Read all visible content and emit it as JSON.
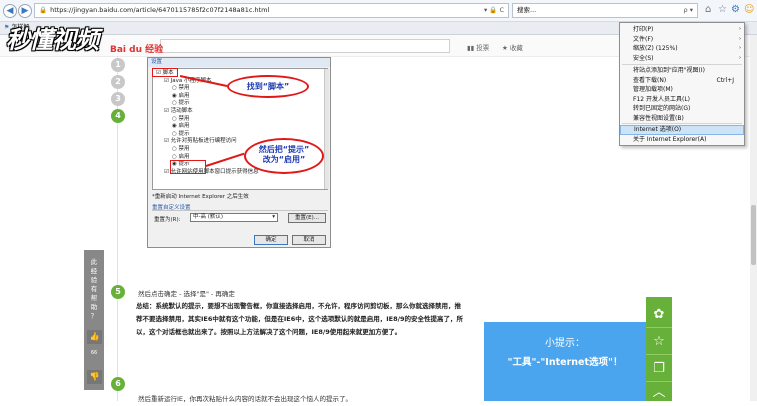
{
  "browser": {
    "url": "https://jingyan.baidu.com/article/6470115785f2c07f2148a81c.html",
    "search_placeholder": "搜索...",
    "tab_label": "怎样解",
    "nav_back": "◀",
    "nav_forward": "▶",
    "lock": "🔒",
    "addr_controls": "▾ 🔒 C",
    "search_controls": "ρ ▾",
    "icons": [
      "home-icon",
      "star-icon",
      "gear-icon",
      "smiley-icon"
    ]
  },
  "watermark": {
    "main": "秒懂视频",
    "sub": "Bai du 经验"
  },
  "header": {
    "link1": "▮▮ 投票",
    "link2": "★ 收藏"
  },
  "steps": [
    "1",
    "2",
    "3",
    "4",
    "5",
    "6"
  ],
  "dialog": {
    "caption": "设置",
    "items": [
      {
        "text": "☑ 脚本",
        "level": 0
      },
      {
        "text": "☑ Java 小程序脚本",
        "level": 1
      },
      {
        "text": "○ 禁用",
        "level": 2
      },
      {
        "text": "◉ 启用",
        "level": 2
      },
      {
        "text": "○ 提示",
        "level": 2
      },
      {
        "text": "☑ 活动脚本",
        "level": 1
      },
      {
        "text": "○ 禁用",
        "level": 2
      },
      {
        "text": "◉ 启用",
        "level": 2
      },
      {
        "text": "○ 提示",
        "level": 2
      },
      {
        "text": "☑ 允许对剪贴板进行编程访问",
        "level": 1
      },
      {
        "text": "○ 禁用",
        "level": 2
      },
      {
        "text": "○ 启用",
        "level": 2
      },
      {
        "text": "◉ 提示",
        "level": 2
      },
      {
        "text": "☑ 允许网站使用脚本窗口提示获得信息",
        "level": 1
      }
    ],
    "note": "*重新启动 Internet Explorer 之后生效",
    "reset_section": "重置自定义设置",
    "reset_to_label": "重置为(R):",
    "reset_select": "中-高 (默认)",
    "reset_button": "重置(E)...",
    "ok_button": "确定",
    "cancel_button": "取消"
  },
  "callouts": {
    "find_script": "找到“脚本”",
    "change_prompt_line1": "然后把“提示”",
    "change_prompt_line2": "改为“启用”"
  },
  "content": {
    "step5_title": "然后点击确定 - 选择\"是\" - 再确定",
    "summary": "总结：系统默认的提示，要想不出现警告框，你直接选择启用，不允许，程序访问剪切板，那么你就选择禁用，推荐不要选择禁用，其实IE6中就有这个功能，但是在IE6中，这个选项默认的就是启用，IE8/9的安全性提高了，所以，这个对话框也就出来了。按照以上方法解决了这个问题，IE8/9使用起来就更加方便了。",
    "step6_text": "然后重新运行IE，你再次粘贴什么内容的话就不会出现这个恼人的提示了。"
  },
  "sidebar_help": {
    "text": "此经验有帮助？",
    "like_count": "66",
    "like_icon": "👍",
    "dislike_icon": "👎"
  },
  "tool_icons": [
    "✿",
    "☆",
    "❐",
    "︿"
  ],
  "tip": {
    "title": "小提示：",
    "text": "\"工具\"-\"Internet选项\"！"
  },
  "menu": {
    "items": [
      {
        "label": "打印(P)",
        "shortcut": "",
        "arrow": "›"
      },
      {
        "label": "文件(F)",
        "shortcut": "",
        "arrow": "›"
      },
      {
        "label": "缩放(Z) (125%)",
        "shortcut": "",
        "arrow": "›"
      },
      {
        "label": "安全(S)",
        "shortcut": "",
        "arrow": "›"
      },
      {
        "label": "将站点添加到\"应用\"视图(I)",
        "shortcut": "",
        "arrow": ""
      },
      {
        "label": "查看下载(N)",
        "shortcut": "Ctrl+J",
        "arrow": ""
      },
      {
        "label": "管理加载项(M)",
        "shortcut": "",
        "arrow": ""
      },
      {
        "label": "F12 开发人员工具(L)",
        "shortcut": "",
        "arrow": ""
      },
      {
        "label": "转到已固定的网站(G)",
        "shortcut": "",
        "arrow": ""
      },
      {
        "label": "兼容性视图设置(B)",
        "shortcut": "",
        "arrow": ""
      },
      {
        "label": "Internet 选项(O)",
        "shortcut": "",
        "arrow": ""
      },
      {
        "label": "关于 Internet Explorer(A)",
        "shortcut": "",
        "arrow": ""
      }
    ]
  }
}
